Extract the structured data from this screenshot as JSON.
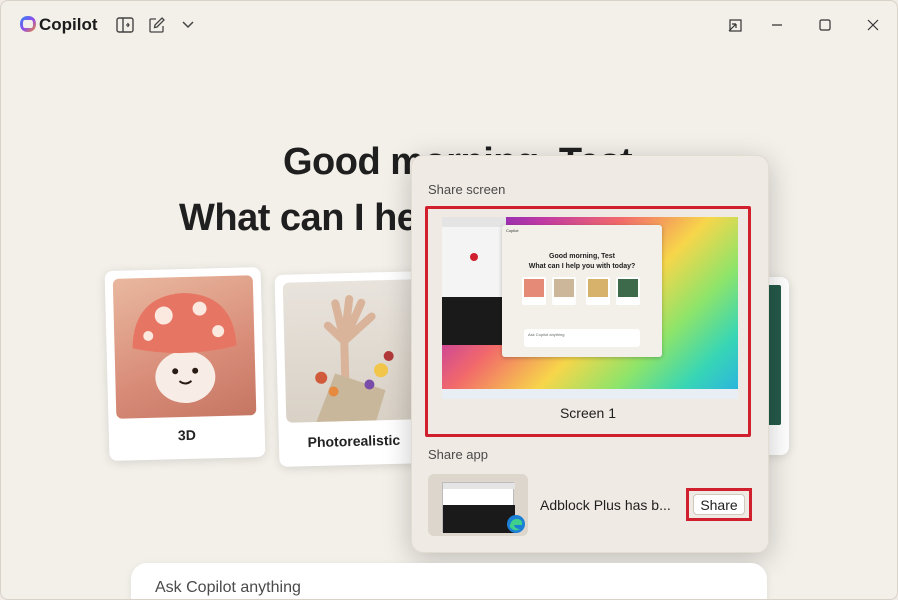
{
  "app": {
    "name": "Copilot"
  },
  "toolbar": {
    "icons": [
      "sidebar-toggle-icon",
      "new-chat-icon",
      "chevron-down-icon"
    ],
    "window": [
      "pin-icon",
      "minimize-icon",
      "maximize-icon",
      "close-icon"
    ]
  },
  "greeting": {
    "line1": "Good morning, Test",
    "line2": "What can I help you with today?"
  },
  "cards": [
    {
      "label": "3D"
    },
    {
      "label": "Photorealistic"
    }
  ],
  "share_popup": {
    "share_screen_title": "Share screen",
    "screen_label": "Screen 1",
    "share_app_title": "Share app",
    "app_name": "Adblock Plus has b...",
    "share_button": "Share",
    "preview": {
      "window_title": "Copilot",
      "greeting1": "Good morning, Test",
      "greeting2": "What can I help you with today?",
      "ask": "Ask Copilot anything"
    }
  },
  "input": {
    "placeholder": "Ask Copilot anything"
  },
  "colors": {
    "highlight": "#d0202e",
    "background": "#f3efe9"
  }
}
